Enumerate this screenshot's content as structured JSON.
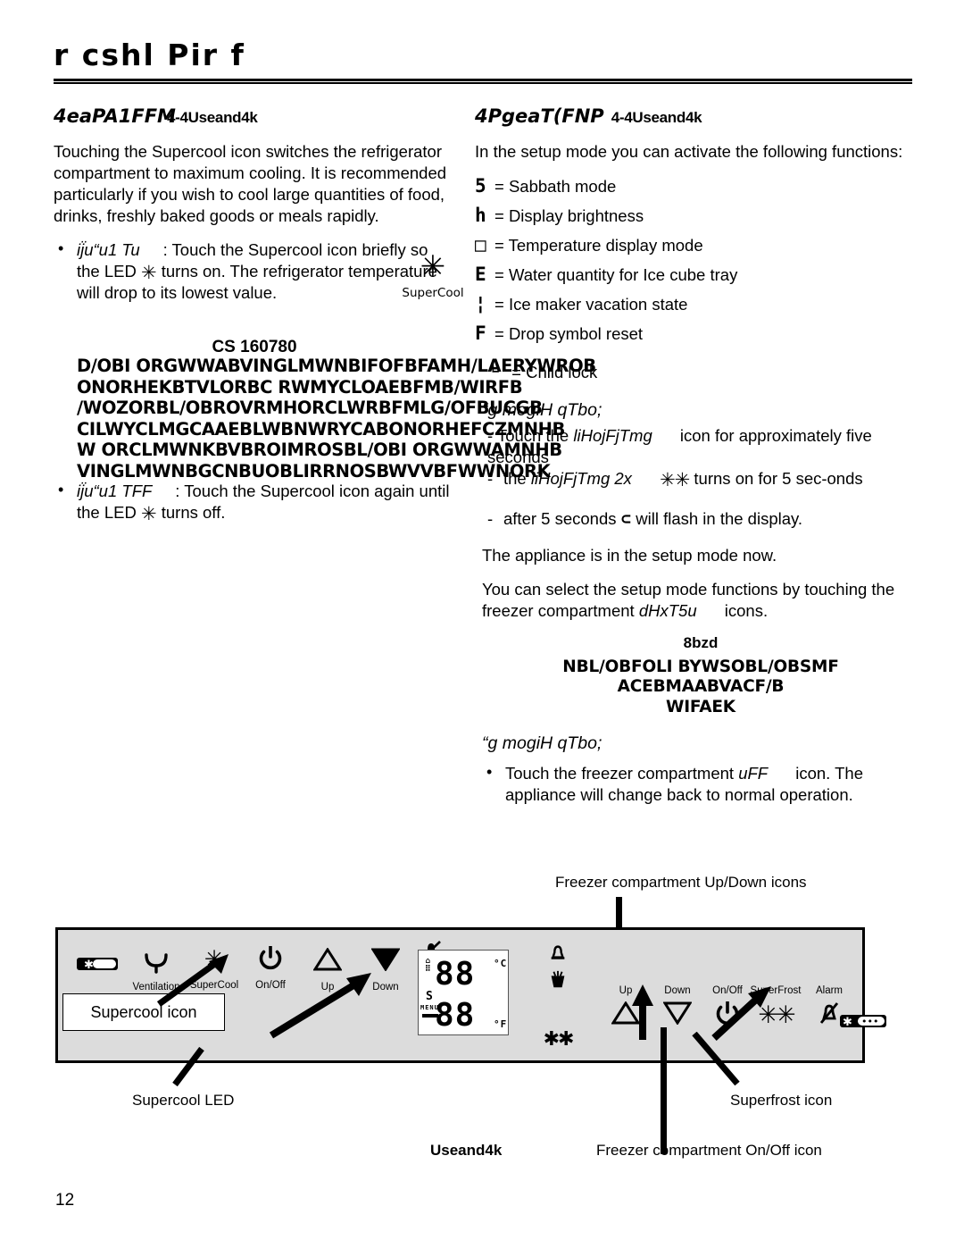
{
  "header": {
    "title": "r  cshl Pir f"
  },
  "page_number": "12",
  "left_column": {
    "section_title_main": "4eaPA1FFM",
    "section_title_sub": "4-4Useand4k",
    "intro_paragraph": "Touching the Supercool icon switches the refrigerator compartment to maximum cooling. It is recommended particularly if you wish to cool large quantities of food, drinks, freshly baked goods or meals rapidly.",
    "bullet_on": {
      "lead": "ij̈u“u1 Tu",
      "text": ": Touch the Supercool icon briefly so the LED",
      "symbol": "✳",
      "text_after": "turns on. The refrigerator temperature will drop to its lowest value."
    },
    "bullet_off": {
      "lead": "ij̈u“u1 TFF",
      "text": ": Touch the Supercool icon again until the LED",
      "symbol": "✳",
      "text_after": "turns off."
    },
    "supercool_icon": {
      "glyph": "✳",
      "label": "SuperCool"
    },
    "cs_caption": "CS 160780"
  },
  "garbled_block": {
    "lines": [
      "D/OBI ORGWWABVINGLMWNBIFOFBFAMH/LAERYWROB",
      "ONORHEKBTVLORBC  RWMYCLOAEBFMB/WIRFB",
      "/WOZORBL/OBROVRMHORCLWRBFMLG/OFBUCGB",
      "CILWYCLMGCAAEBLWBNWRYCABONORHEFCZMNHB",
      "W ORCLMWNKBVBROIMROSBL/OBI ORGWWAMNHB",
      "VINGLMWNBGCNBUOBLIRRNOSBWVVBFWWNORK"
    ]
  },
  "right_column": {
    "section_title_main": "4PgeaT(FNP",
    "section_title_sub": "4-4Useand4k",
    "intro_paragraph": "In the setup mode you can activate the following functions:",
    "symbol_functions": [
      {
        "symbol": "5",
        "text": "= Sabbath mode"
      },
      {
        "symbol": "h",
        "text": "= Display brightness"
      },
      {
        "symbol": "□",
        "text": "= Temperature display mode"
      },
      {
        "symbol": "E",
        "text": "= Water quantity for Ice cube tray"
      },
      {
        "symbol": "¦",
        "text": "= Ice maker vacation state"
      },
      {
        "symbol": "F",
        "text": "= Drop symbol reset"
      },
      {
        "symbol": "└",
        "text": "= Child lock"
      }
    ],
    "activation_heading": "“g mogiH qTbo;",
    "steps": [
      {
        "pre": "Touch the",
        "ital": "liHojFjTmg",
        "post": "icon for approximately five seconds"
      },
      {
        "pre": "the",
        "ital": "liHojFjTmg 2x",
        "symbol": "✳✳",
        "post": "turns on for 5 sec-onds"
      },
      {
        "pre": "after 5 seconds",
        "symbol": "⊂",
        "post": "will flash in the display."
      }
    ],
    "after_setup": "The appliance is in the setup mode now.",
    "select_functions_pre": "You can select the setup mode functions by touching the freezer compartment",
    "select_functions_ital": "dHxT5u",
    "select_functions_post": "icons.",
    "note_kicker": "8bzd",
    "note_garbled_line1": "NBL/OBFOLI BYWSOBL/OBSMF ACEBMAABVACF/B",
    "note_garbled_line2": "WIFAEK",
    "exit_heading": "“g mogiH qTbo;",
    "exit_bullet_pre": "Touch the freezer compartment",
    "exit_bullet_ital": "uFF",
    "exit_bullet_post": "icon. The appliance will change back to normal operation."
  },
  "diagram": {
    "left_icons": [
      {
        "glyph": "✳▭",
        "caption": ""
      },
      {
        "glyph": "⤵",
        "caption": "Ventilation"
      },
      {
        "glyph": "✳",
        "caption": "SuperCool"
      },
      {
        "glyph": "⏻",
        "caption": "On/Off"
      },
      {
        "glyph": "△",
        "caption": "Up"
      },
      {
        "glyph": "▽",
        "caption": "Down"
      }
    ],
    "left_stack_icons": [
      "alarm-off",
      "ventilation",
      "supercool",
      "child-lock"
    ],
    "lcd": {
      "top_digits": "88",
      "bottom_digits": "88",
      "unit_top": "°C",
      "unit_bottom": "°F",
      "marker_s": "S",
      "marker_menu": "MENU"
    },
    "right_stack_icons": [
      "alarm-bell",
      "ice-cube",
      "superfrost-double-star"
    ],
    "right_icons": [
      {
        "glyph": "△",
        "caption": "Up"
      },
      {
        "glyph": "▽",
        "caption": "Down"
      },
      {
        "glyph": "⏻",
        "caption": "On/Off"
      },
      {
        "glyph": "✳✳",
        "caption": "SuperFrost"
      },
      {
        "glyph": "⌀",
        "caption": "Alarm"
      },
      {
        "glyph": "✳⋯",
        "caption": ""
      }
    ],
    "callouts": {
      "top": "Freezer compartment Up/Down icons",
      "supercool_icon": "Supercool icon",
      "supercool_led": "Supercool LED",
      "superfrost_icon": "Superfrost icon",
      "freezer_onoff": "Freezer compartment On/Off icon",
      "bottom_center": "Useand4k"
    }
  }
}
